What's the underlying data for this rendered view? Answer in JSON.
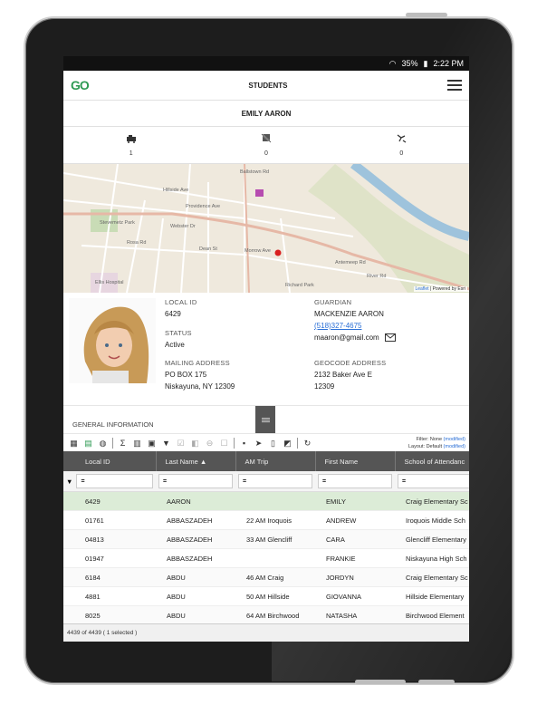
{
  "status_bar": {
    "battery": "35%",
    "time": "2:22 PM"
  },
  "app": {
    "logo": "GO",
    "title": "STUDENTS"
  },
  "student": {
    "name": "EMILY AARON"
  },
  "stats": [
    {
      "icon": "bus-icon",
      "value": "1"
    },
    {
      "icon": "no-bus-icon",
      "value": "0"
    },
    {
      "icon": "route-icon",
      "value": "0"
    }
  ],
  "map": {
    "labels": [
      "Hillside Ave",
      "Providence Ave",
      "Ballstown Rd",
      "Webster Dr",
      "Rosa Rd",
      "Morrow Ave",
      "Dean St",
      "Richard Park",
      "Antemeep Rd",
      "River Rd",
      "Stevemetz Park",
      "Ellis Hospital"
    ],
    "attribution_link": "Leaflet",
    "attribution_text": "| Powered by Esri"
  },
  "profile": {
    "local_id_label": "LOCAL ID",
    "local_id": "6429",
    "status_label": "STATUS",
    "status": "Active",
    "mailing_label": "MAILING ADDRESS",
    "mailing_line1": "PO BOX 175",
    "mailing_line2": "Niskayuna, NY 12309",
    "guardian_label": "GUARDIAN",
    "guardian_name": "MACKENZIE AARON",
    "guardian_phone": "(518)327-4675",
    "guardian_email": "maaron@gmail.com",
    "geocode_label": "GEOCODE ADDRESS",
    "geocode_line1": "2132 Baker Ave E",
    "geocode_line2": "12309"
  },
  "general_info_label": "GENERAL INFORMATION",
  "filter_info": {
    "filter_label": "Filter:",
    "filter_value": "None",
    "filter_mod": "(modified)",
    "layout_label": "Layout:",
    "layout_value": "Default",
    "layout_mod": "(modified)"
  },
  "grid": {
    "columns": [
      "Local ID",
      "Last Name ▲",
      "AM Trip",
      "First Name",
      "School of Attendanc"
    ],
    "filter_op": "=",
    "rows": [
      {
        "id": "6429",
        "last": "AARON",
        "trip": "",
        "first": "EMILY",
        "school": "Craig Elementary Sc"
      },
      {
        "id": "01761",
        "last": "ABBASZADEH",
        "trip": "22 AM Iroquois",
        "first": "ANDREW",
        "school": "Iroquois Middle Sch"
      },
      {
        "id": "04813",
        "last": "ABBASZADEH",
        "trip": "33 AM Glencliff",
        "first": "CARA",
        "school": "Glencliff Elementary"
      },
      {
        "id": "01947",
        "last": "ABBASZADEH",
        "trip": "",
        "first": "FRANKIE",
        "school": "Niskayuna High Sch"
      },
      {
        "id": "6184",
        "last": "ABDU",
        "trip": "46 AM Craig",
        "first": "JORDYN",
        "school": "Craig Elementary Sc"
      },
      {
        "id": "4881",
        "last": "ABDU",
        "trip": "50 AM Hillside",
        "first": "GIOVANNA",
        "school": "Hillside Elementary"
      },
      {
        "id": "8025",
        "last": "ABDU",
        "trip": "64 AM Birchwood",
        "first": "NATASHA",
        "school": "Birchwood Element"
      }
    ]
  },
  "footer": "4439 of 4439 ( 1 selected )"
}
